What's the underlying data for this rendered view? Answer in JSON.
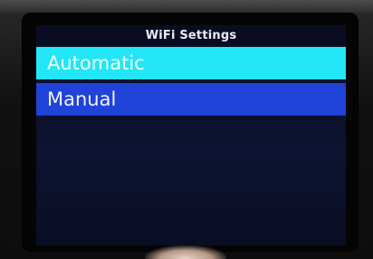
{
  "screen": {
    "title": "WiFi Settings"
  },
  "menu": {
    "items": [
      {
        "label": "Automatic",
        "state": "highlighted"
      },
      {
        "label": "Manual",
        "state": "selected"
      }
    ]
  },
  "colors": {
    "background": "#0d1330",
    "highlight": "#22e6f5",
    "selected": "#2043d8",
    "text": "#f2ffff"
  }
}
